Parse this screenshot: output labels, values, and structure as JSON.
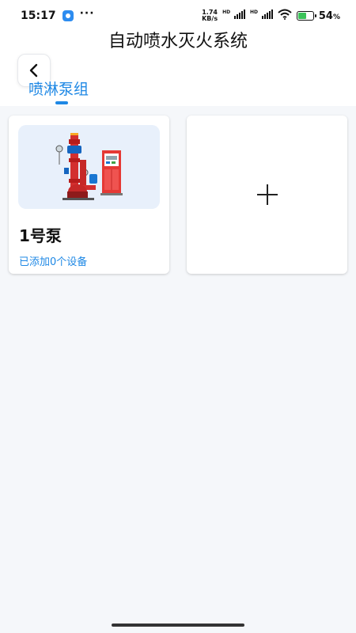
{
  "status_bar": {
    "time": "15:17",
    "more": "···",
    "net_speed_value": "1.74",
    "net_speed_unit": "KB/s",
    "hd1": "HD",
    "hd2": "HD",
    "battery_percent": "54",
    "battery_unit": "%",
    "battery_level": 0.54
  },
  "header": {
    "title": "自动喷水灭火系统",
    "back_icon": "chevron-left-icon"
  },
  "tabs": [
    {
      "label": "喷淋泵组",
      "active": true
    }
  ],
  "pump_groups": [
    {
      "name": "1号泵",
      "status": "已添加0个设备",
      "image": "fire-pump-unit"
    }
  ],
  "add_card": {
    "icon": "plus-icon"
  },
  "colors": {
    "accent": "#1e88e5",
    "background": "#f5f7fa",
    "card": "#ffffff",
    "pump_red": "#d32f2f"
  }
}
